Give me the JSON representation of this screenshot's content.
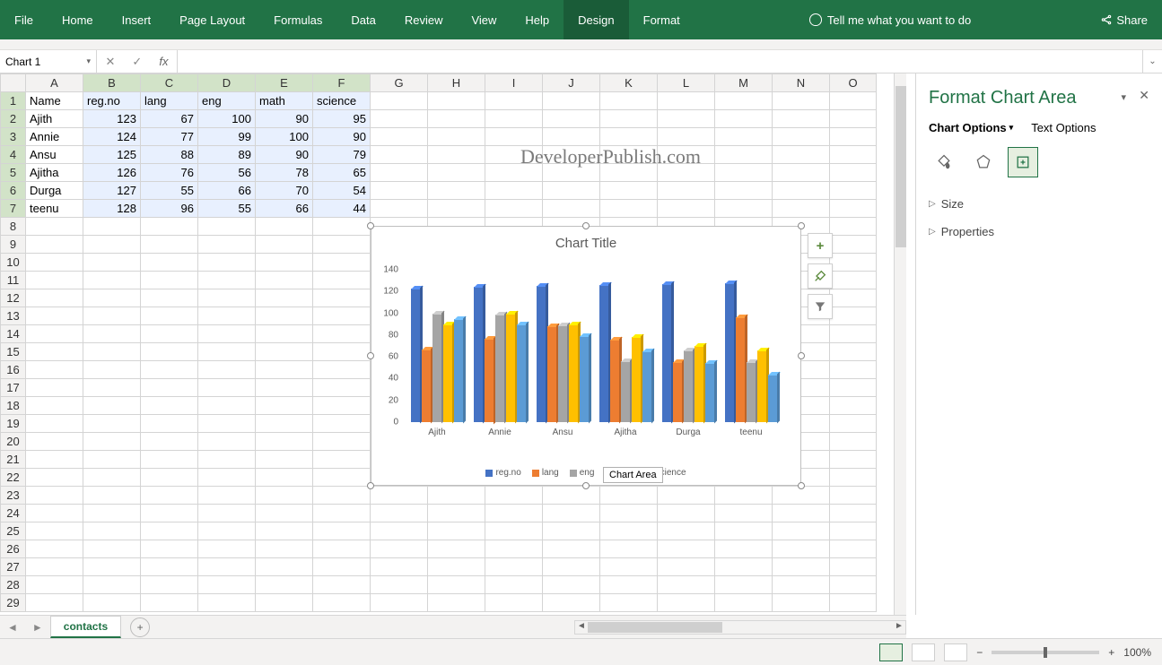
{
  "ribbon": {
    "tabs": [
      "File",
      "Home",
      "Insert",
      "Page Layout",
      "Formulas",
      "Data",
      "Review",
      "View",
      "Help",
      "Design",
      "Format"
    ],
    "active_tab": "Design",
    "tell_me": "Tell me what you want to do",
    "share": "Share"
  },
  "namebox": {
    "value": "Chart 1"
  },
  "formula_bar": {
    "value": ""
  },
  "watermark": "DeveloperPublish.com",
  "columns": [
    "A",
    "B",
    "C",
    "D",
    "E",
    "F",
    "G",
    "H",
    "I",
    "J",
    "K",
    "L",
    "M",
    "N",
    "O"
  ],
  "row_count": 29,
  "table": {
    "headers": [
      "Name",
      "reg.no",
      "lang",
      "eng",
      "math",
      "science"
    ],
    "rows": [
      [
        "Ajith",
        123,
        67,
        100,
        90,
        95
      ],
      [
        "Annie",
        124,
        77,
        99,
        100,
        90
      ],
      [
        "Ansu",
        125,
        88,
        89,
        90,
        79
      ],
      [
        "Ajitha",
        126,
        76,
        56,
        78,
        65
      ],
      [
        "Durga",
        127,
        55,
        66,
        70,
        54
      ],
      [
        "teenu",
        128,
        96,
        55,
        66,
        44
      ]
    ]
  },
  "chart_data": {
    "type": "bar",
    "title": "Chart Title",
    "categories": [
      "Ajith",
      "Annie",
      "Ansu",
      "Ajitha",
      "Durga",
      "teenu"
    ],
    "series": [
      {
        "name": "reg.no",
        "color": "#4472c4",
        "values": [
          123,
          124,
          125,
          126,
          127,
          128
        ]
      },
      {
        "name": "lang",
        "color": "#ed7d31",
        "values": [
          67,
          77,
          88,
          76,
          55,
          96
        ]
      },
      {
        "name": "eng",
        "color": "#a5a5a5",
        "values": [
          100,
          99,
          89,
          56,
          66,
          55
        ]
      },
      {
        "name": "math",
        "color": "#ffc000",
        "values": [
          90,
          100,
          90,
          78,
          70,
          66
        ]
      },
      {
        "name": "science",
        "color": "#5b9bd5",
        "values": [
          95,
          90,
          79,
          65,
          54,
          44
        ]
      }
    ],
    "yticks": [
      0,
      20,
      40,
      60,
      80,
      100,
      120,
      140
    ],
    "ylim": [
      0,
      140
    ],
    "tooltip": "Chart Area"
  },
  "chart_side_buttons": [
    "plus",
    "brush",
    "filter"
  ],
  "pane": {
    "title": "Format Chart Area",
    "options": [
      "Chart Options",
      "Text Options"
    ],
    "active_option": "Chart Options",
    "sections": [
      "Size",
      "Properties"
    ]
  },
  "sheet_tabs": {
    "active": "contacts"
  },
  "status": {
    "zoom": "100%"
  }
}
